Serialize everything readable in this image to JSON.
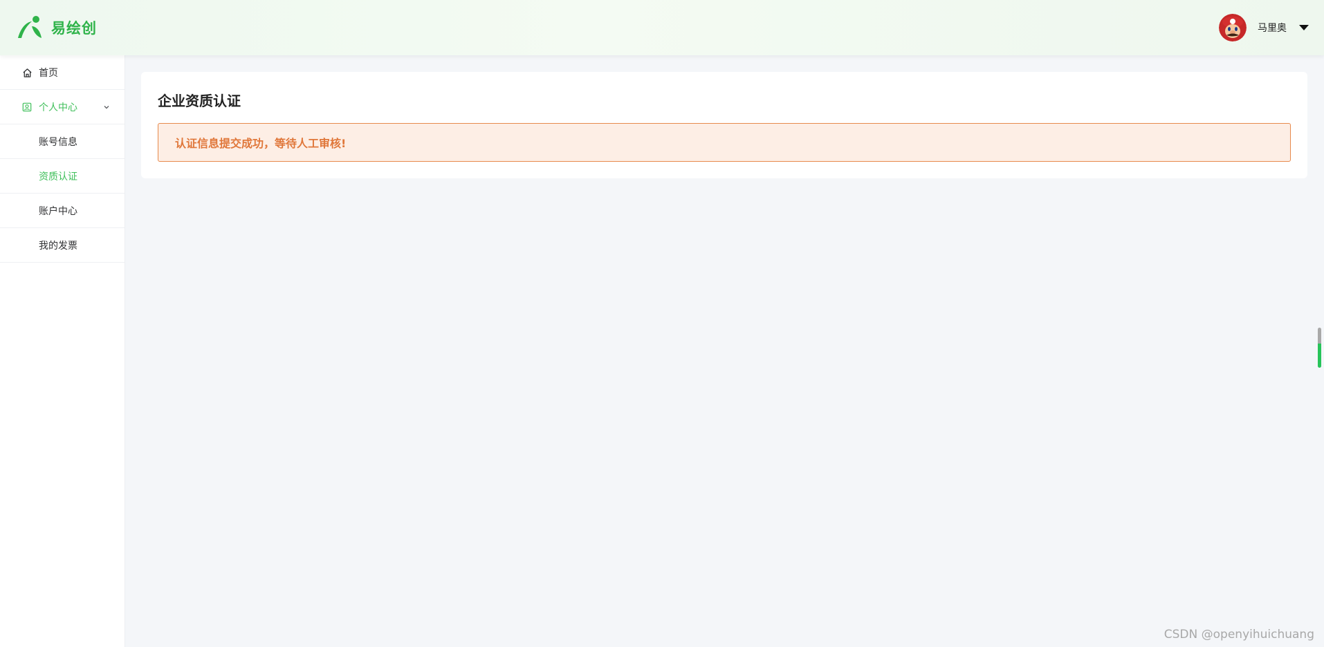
{
  "header": {
    "brand_name": "易绘创",
    "user_name": "马里奥"
  },
  "sidebar": {
    "items": [
      {
        "label": "首页",
        "icon": "home-icon"
      },
      {
        "label": "个人中心",
        "icon": "user-icon",
        "expanded": true
      },
      {
        "label": "账号信息"
      },
      {
        "label": "资质认证",
        "active": true
      },
      {
        "label": "账户中心"
      },
      {
        "label": "我的发票"
      }
    ]
  },
  "main": {
    "card_title": "企业资质认证",
    "alert_message": "认证信息提交成功，等待人工审核!"
  },
  "watermark": "CSDN @openyihuichuang",
  "colors": {
    "brand_green": "#2fb34a",
    "active_green": "#3fbf5a",
    "alert_orange": "#e0773a",
    "alert_bg": "#fdeee5",
    "page_bg": "#f4f6f9"
  }
}
